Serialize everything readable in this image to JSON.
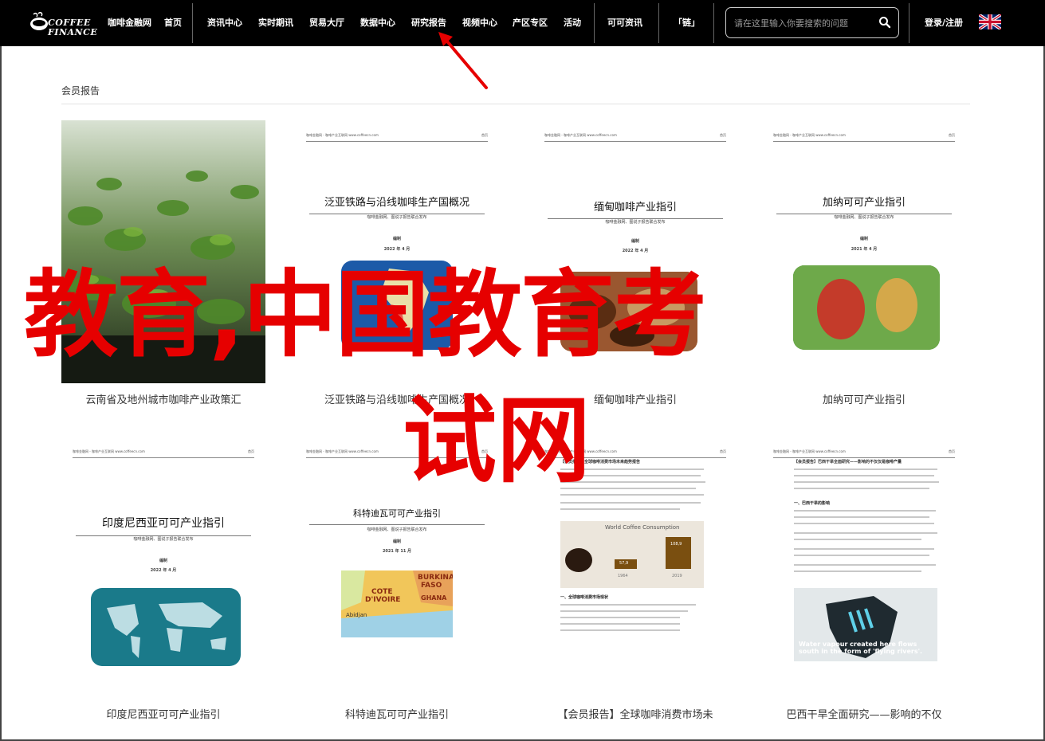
{
  "header": {
    "logo_line1": "COFFEE",
    "logo_line2": "FINANCE",
    "nav": [
      "咖啡金融网",
      "首页",
      "资讯中心",
      "实时期讯",
      "贸易大厅",
      "数据中心",
      "研究报告",
      "视频中心",
      "产区专区",
      "活动",
      "可可资讯",
      "「链」"
    ],
    "search_placeholder": "请在这里输入你要搜索的问题",
    "login_label": "登录/注册",
    "flag_icon": "uk-flag-icon"
  },
  "section": {
    "title": "会员报告"
  },
  "overlay_text": {
    "line1": "教育,中国教育考",
    "line2": "试网"
  },
  "cards": [
    {
      "caption": "云南省及地州城市咖啡产业政策汇",
      "doc_title": "",
      "doc_sub": "",
      "doc_date": ""
    },
    {
      "caption": "泛亚铁路与沿线咖啡生产国概况",
      "doc_title": "泛亚铁路与沿线咖啡生产国概况",
      "doc_sub": "咖啡金融网、图说子报告联合发布",
      "doc_org": "编制",
      "doc_date": "2022 年 4 月"
    },
    {
      "caption": "缅甸咖啡产业指引",
      "doc_title": "缅甸咖啡产业指引",
      "doc_sub": "咖啡金融网、图说子报告联合发布",
      "doc_org": "编制",
      "doc_date": "2022 年 4 月"
    },
    {
      "caption": "加纳可可产业指引",
      "doc_title": "加纳可可产业指引",
      "doc_sub": "咖啡金融网、图说子报告联合发布",
      "doc_org": "编制",
      "doc_date": "2021 年 4 月"
    },
    {
      "caption": "印度尼西亚可可产业指引",
      "doc_title": "印度尼西亚可可产业指引",
      "doc_sub": "咖啡金融网、图说子报告联合发布",
      "doc_org": "编制",
      "doc_date": "2022 年 4 月"
    },
    {
      "caption": "科特迪瓦可可产业指引",
      "doc_title": "科特迪瓦可可产业指引",
      "doc_sub": "咖啡金融网、图说子报告联合发布",
      "doc_org": "编制",
      "doc_date": "2021 年 11 月",
      "map_labels": [
        "BURKINA",
        "FASO",
        "COTE",
        "D'IVOIRE",
        "GHANA",
        "Abidjan"
      ]
    },
    {
      "caption": "【会员报告】全球咖啡消费市场未",
      "doc_title": "【会员报告】全球咖啡消费市场未来趋势报告",
      "chart_title": "World Coffee Consumption",
      "chart_values": [
        "57,9",
        "108,9"
      ],
      "chart_years": [
        "1964",
        "2019"
      ],
      "section_head": "一、全球咖啡消费市场现状"
    },
    {
      "caption": "巴西干旱全面研究——影响的不仅",
      "doc_title": "【会员报告】巴西干旱全面研究——影响的不仅仅是咖啡产量",
      "section_head": "一、巴西干旱的影响",
      "photo_caption": "Water vapour created here flows south in the form of 'flying rivers'."
    }
  ],
  "doc_header": {
    "left": "咖啡金融网 - 咖啡产业互联网 www.coffeecn.com",
    "links": [
      "首页",
      "资讯",
      "行情",
      "报告"
    ]
  },
  "colors": {
    "overlay": "#e60000",
    "topbar": "#000000"
  }
}
